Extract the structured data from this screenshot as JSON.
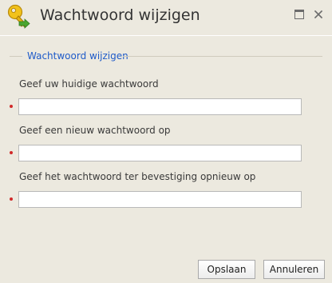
{
  "window": {
    "title": "Wachtwoord wijzigen",
    "icon": "key-icon",
    "maximize_icon": "maximize-icon",
    "close_icon": "close-icon"
  },
  "form": {
    "legend": "Wachtwoord wijzigen",
    "fields": [
      {
        "label": "Geef uw huidige wachtwoord",
        "value": "",
        "required": true
      },
      {
        "label": "Geef een nieuw wachtwoord op",
        "value": "",
        "required": true
      },
      {
        "label": "Geef het wachtwoord ter bevestiging opnieuw op",
        "value": "",
        "required": true
      }
    ]
  },
  "buttons": {
    "save_label": "Opslaan",
    "cancel_label": "Annuleren"
  },
  "colors": {
    "background": "#ece9df",
    "legend": "#1f5bc9",
    "required_marker": "#d12a2a"
  }
}
